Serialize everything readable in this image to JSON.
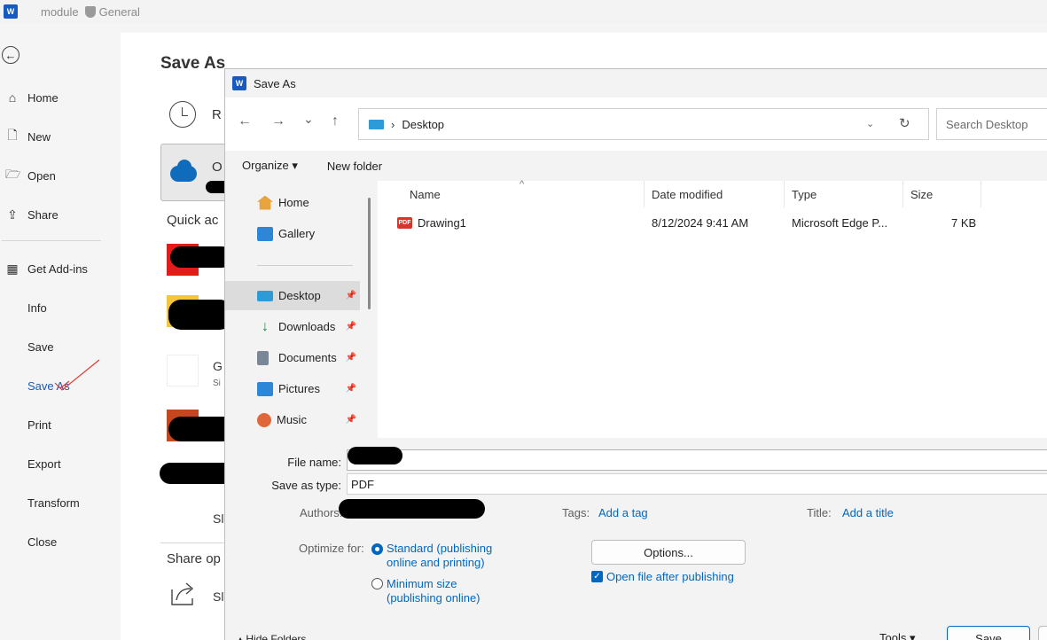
{
  "app": {
    "title": "module",
    "sensitivity": "General",
    "logo_letter": "W"
  },
  "leftnav": {
    "back_glyph": "←",
    "items": [
      {
        "label": "Home",
        "icon": "home-icon",
        "glyph": "⌂"
      },
      {
        "label": "New",
        "icon": "new-document-icon",
        "glyph": "🗋"
      },
      {
        "label": "Open",
        "icon": "open-folder-icon",
        "glyph": "🗁"
      },
      {
        "label": "Share",
        "icon": "share-icon",
        "glyph": "⇪"
      },
      {
        "label": "Get Add-ins",
        "icon": "add-ins-icon",
        "glyph": "▦"
      },
      {
        "label": "Info"
      },
      {
        "label": "Save"
      },
      {
        "label": "Save As"
      },
      {
        "label": "Print"
      },
      {
        "label": "Export"
      },
      {
        "label": "Transform"
      },
      {
        "label": "Close"
      }
    ]
  },
  "backstage": {
    "title": "Save As",
    "recent_cut": "R",
    "onedrive_cut": "O",
    "quick_access": "Quick ac",
    "g_cut": "G",
    "si_cut": "Si",
    "sh_cut": "Sl",
    "share_options": "Share op",
    "share_cut": "Sl"
  },
  "dialog": {
    "title": "Save As",
    "logo_letter": "W",
    "nav": {
      "back": "←",
      "forward": "→",
      "recent": "⌄",
      "up": "↑",
      "refresh": "↻",
      "chevron": "⌄"
    },
    "address": {
      "separator": "›",
      "location": "Desktop"
    },
    "search_placeholder": "Search Desktop",
    "commands": {
      "organize": "Organize ▾",
      "new_folder": "New folder"
    },
    "nav_pane": [
      {
        "label": "Home",
        "icon": "home-icon",
        "color": "#e8a33d"
      },
      {
        "label": "Gallery",
        "icon": "gallery-icon",
        "color": "#2e86d6"
      },
      {
        "label": "Desktop",
        "icon": "desktop-folder-icon",
        "color": "#2d9bd7",
        "selected": true,
        "pinned": true
      },
      {
        "label": "Downloads",
        "icon": "downloads-icon",
        "color": "#1b8a3f",
        "pinned": true
      },
      {
        "label": "Documents",
        "icon": "documents-icon",
        "color": "#7a8796",
        "pinned": true
      },
      {
        "label": "Pictures",
        "icon": "pictures-icon",
        "color": "#2e86d6",
        "pinned": true
      },
      {
        "label": "Music",
        "icon": "music-icon",
        "color": "#e0673a",
        "pinned": true
      }
    ],
    "columns": [
      "Name",
      "Date modified",
      "Type",
      "Size"
    ],
    "files": [
      {
        "name": "Drawing1",
        "date": "8/12/2024 9:41 AM",
        "type": "Microsoft Edge P...",
        "size": "7 KB",
        "icon": "pdf-icon"
      }
    ],
    "form": {
      "file_name_label": "File name:",
      "file_name_value": "",
      "save_type_label": "Save as type:",
      "save_type_value": "PDF",
      "authors_label": "Authors:",
      "tags_label": "Tags:",
      "tags_link": "Add a tag",
      "title_label": "Title:",
      "title_link": "Add a title",
      "optimize_label": "Optimize for:",
      "option_standard": "Standard (publishing online and printing)",
      "option_minimum": "Minimum size (publishing online)",
      "options_button": "Options...",
      "open_after": "Open file after publishing",
      "hide_folders": "Hide Folders",
      "tools": "Tools",
      "save_button": "Save"
    }
  },
  "colors": {
    "accent": "#185abd",
    "link": "#0067c0",
    "annotation": "#e53935"
  }
}
